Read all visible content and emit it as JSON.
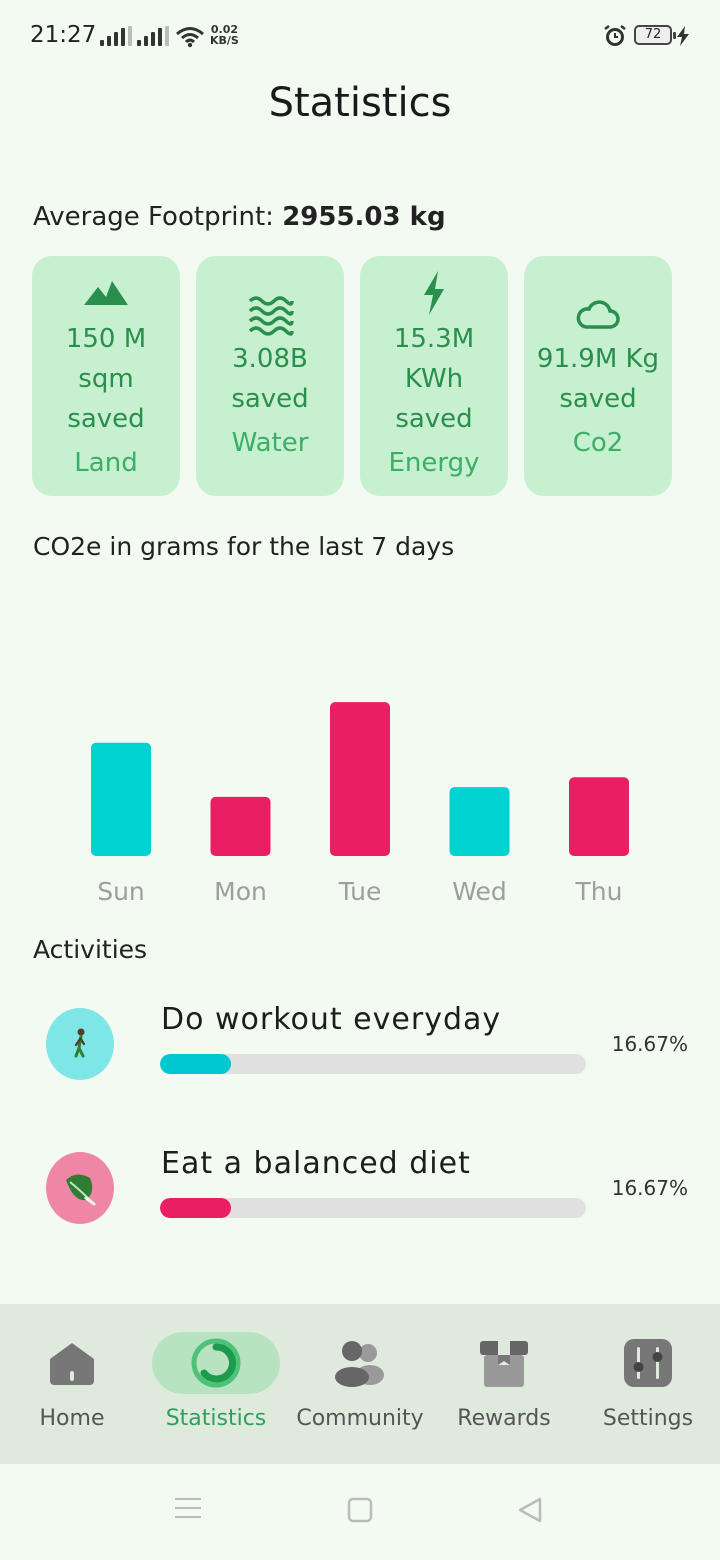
{
  "status_bar": {
    "time": "21:27",
    "net_speed": "0.02",
    "net_unit": "KB/S",
    "battery": "72"
  },
  "header": {
    "title": "Statistics"
  },
  "footprint": {
    "label": "Average Footprint: ",
    "value": "2955.03 kg"
  },
  "cards": [
    {
      "icon": "mountain-icon",
      "lines": [
        "150 M",
        "sqm",
        "saved"
      ],
      "label": "Land"
    },
    {
      "icon": "water-waves-icon",
      "lines": [
        "3.08B",
        "saved"
      ],
      "label": "Water"
    },
    {
      "icon": "lightning-icon",
      "lines": [
        "15.3M",
        "KWh",
        "saved"
      ],
      "label": "Energy"
    },
    {
      "icon": "cloud-icon",
      "lines": [
        "91.9M Kg",
        "saved"
      ],
      "label": "Co2"
    }
  ],
  "chart_title": "CO2e in grams for the last 7 days",
  "chart_data": {
    "type": "bar",
    "categories": [
      "Sun",
      "Mon",
      "Tue",
      "Wed",
      "Thu"
    ],
    "values": [
      92,
      48,
      125,
      56,
      64
    ],
    "colors": [
      "#00d1d1",
      "#e91e63",
      "#e91e63",
      "#00d1d1",
      "#e91e63"
    ],
    "title": "CO2e in grams for the last 7 days",
    "ylim": [
      0,
      130
    ],
    "grid": false
  },
  "activities_title": "Activities",
  "activities": [
    {
      "name": "Do workout everyday",
      "percent_label": "16.67%",
      "progress": 0.1667,
      "icon": "walking-person-icon",
      "avatar_color": "#7ee6e6",
      "bar_color": "#00c8d0"
    },
    {
      "name": "Eat a balanced diet",
      "percent_label": "16.67%",
      "progress": 0.1667,
      "icon": "leafy-greens-icon",
      "avatar_color": "#ef86a6",
      "bar_color": "#e91e63"
    }
  ],
  "nav": [
    {
      "label": "Home",
      "icon": "home-icon",
      "active": false
    },
    {
      "label": "Statistics",
      "icon": "statistics-ring-icon",
      "active": true
    },
    {
      "label": "Community",
      "icon": "community-icon",
      "active": false
    },
    {
      "label": "Rewards",
      "icon": "gift-icon",
      "active": false
    },
    {
      "label": "Settings",
      "icon": "sliders-icon",
      "active": false
    }
  ],
  "colors": {
    "accent": "#2f9f5d",
    "card_bg": "#c6f0cf",
    "cyan": "#00d1d1",
    "pink": "#e91e63"
  }
}
